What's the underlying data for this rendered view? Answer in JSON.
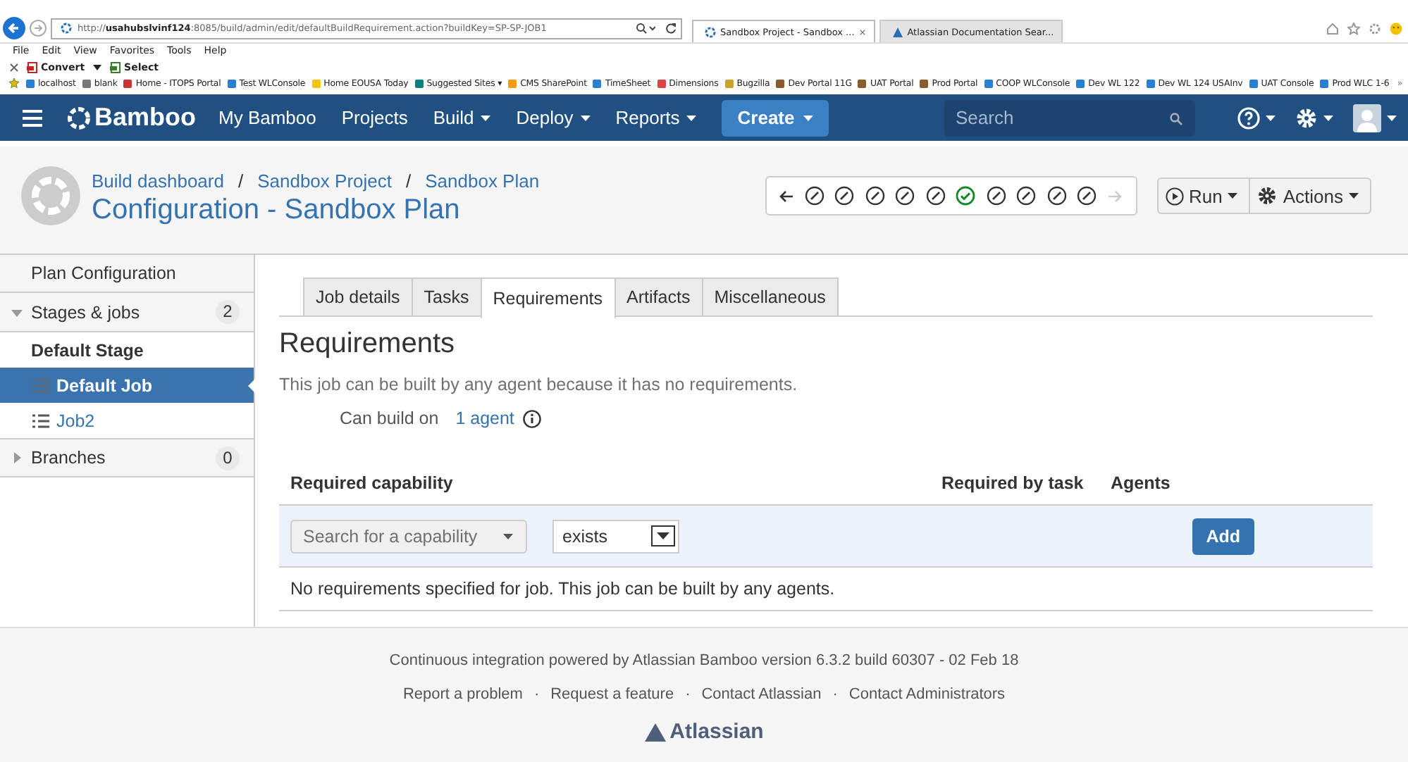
{
  "browser": {
    "address": "http://**usahubslvinf124**:8085/build/admin/edit/defaultBuildRequirement.action?buildKey=SP-SP-JOB1",
    "tabs": [
      {
        "title": "Sandbox Project - Sandbox ...",
        "selected": true,
        "close": "×"
      },
      {
        "title": "Atlassian Documentation Sear...",
        "selected": false
      }
    ],
    "menu": [
      "File",
      "Edit",
      "View",
      "Favorites",
      "Tools",
      "Help"
    ],
    "command_bar": [
      "Convert",
      "Select"
    ],
    "favorites": [
      "localhost",
      "blank",
      "Home - ITOPS Portal",
      "Test WLConsole",
      "Home  EOUSA Today",
      "Suggested Sites ▾",
      "CMS SharePoint",
      "TimeSheet",
      "Dimensions",
      "Bugzilla",
      "Dev Portal 11G",
      "UAT Portal",
      "Prod Portal",
      "COOP WLConsole",
      "Dev WL 122",
      "Dev WL 124 USAInv",
      "UAT Console",
      "Prod WLC 1-6"
    ],
    "favorites_more": "»"
  },
  "app_header": {
    "logo": "Bamboo",
    "nav": [
      {
        "label": "My Bamboo",
        "dropdown": false
      },
      {
        "label": "Projects",
        "dropdown": false
      },
      {
        "label": "Build",
        "dropdown": true
      },
      {
        "label": "Deploy",
        "dropdown": true
      },
      {
        "label": "Reports",
        "dropdown": true
      }
    ],
    "create": "Create",
    "search": {
      "placeholder": "Search"
    }
  },
  "page_header": {
    "breadcrumbs": [
      {
        "label": "Build dashboard"
      },
      {
        "separator": "/",
        "label": "Sandbox Project"
      },
      {
        "separator": "/",
        "label": "Sandbox Plan"
      }
    ],
    "title": "Configuration - Sandbox Plan",
    "build_history": [
      {
        "kind": "notbuilt"
      },
      {
        "kind": "notbuilt"
      },
      {
        "kind": "notbuilt"
      },
      {
        "kind": "notbuilt"
      },
      {
        "kind": "notbuilt"
      },
      {
        "kind": "success"
      },
      {
        "kind": "notbuilt"
      },
      {
        "kind": "notbuilt"
      },
      {
        "kind": "notbuilt"
      },
      {
        "kind": "notbuilt"
      }
    ],
    "run": "Run",
    "actions": "Actions"
  },
  "sidebar": {
    "items": [
      {
        "kind": "section",
        "label": "Plan Configuration",
        "selected": false
      },
      {
        "kind": "group",
        "label": "Stages & jobs",
        "count": "2",
        "expanded": true,
        "selected": false
      },
      {
        "kind": "stage",
        "label": "Default Stage",
        "selected": false
      },
      {
        "kind": "job",
        "label": "Default Job",
        "selected": true
      },
      {
        "kind": "job",
        "label": "Job2",
        "selected": false
      },
      {
        "kind": "group",
        "label": "Branches",
        "count": "0",
        "expanded": false,
        "selected": false
      }
    ]
  },
  "tabs": [
    {
      "label": "Job details",
      "selected": false
    },
    {
      "label": "Tasks",
      "selected": false
    },
    {
      "label": "Requirements",
      "selected": true
    },
    {
      "label": "Artifacts",
      "selected": false
    },
    {
      "label": "Miscellaneous",
      "selected": false
    }
  ],
  "content": {
    "heading": "Requirements",
    "description": "This job can be built by any agent because it has no requirements.",
    "can_build_on": "Can build on",
    "agents_link": "1 agent",
    "table": {
      "columns": [
        "Required capability",
        "Required by task",
        "Agents"
      ],
      "capability": {
        "placeholder": "Search for a capability"
      },
      "condition": "exists",
      "add": "Add",
      "empty_message": "No requirements specified for job. This job can be built by any agents."
    }
  },
  "footer": {
    "text": "Continuous integration powered by Atlassian Bamboo version 6.3.2 build 60307 - 02 Feb 18",
    "links": [
      {
        "label": "Report a problem"
      },
      {
        "separator": "·",
        "label": "Request a feature"
      },
      {
        "separator": "·",
        "label": "Contact Atlassian"
      },
      {
        "separator": "·",
        "label": "Contact Administrators"
      }
    ],
    "logo": "Atlassian"
  }
}
